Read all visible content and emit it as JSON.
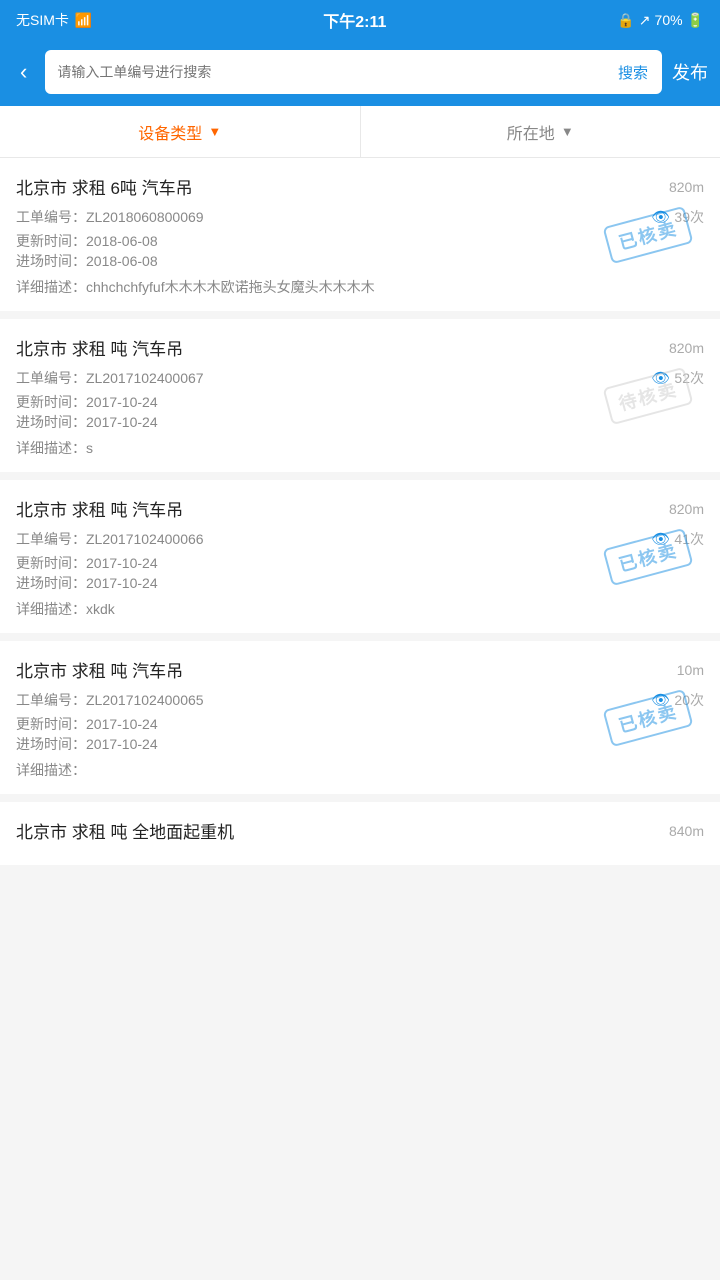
{
  "statusBar": {
    "left": "无SIM卡 🛜",
    "time": "下午2:11",
    "battery": "70%"
  },
  "header": {
    "backLabel": "‹",
    "searchPlaceholder": "请输入工单编号进行搜索",
    "searchBtnLabel": "搜索",
    "publishBtnLabel": "发布"
  },
  "filterBar": {
    "deviceType": {
      "label": "设备类型",
      "active": true
    },
    "location": {
      "label": "所在地",
      "active": false
    }
  },
  "items": [
    {
      "title": "北京市 求租 6吨 汽车吊",
      "distance": "820m",
      "orderNo": "工单编号：ZL2018060800069",
      "views": "39次",
      "updateTime": "更新时间：2018-06-08",
      "entryTime": "进场时间：2018-06-08",
      "desc": "详细描述：chhchchfyfuf木木木木欧诺拖头女魔头木木木木",
      "stamp": "已核卖",
      "stampType": "verified"
    },
    {
      "title": "北京市 求租 吨 汽车吊",
      "distance": "820m",
      "orderNo": "工单编号：ZL2017102400067",
      "views": "52次",
      "updateTime": "更新时间：2017-10-24",
      "entryTime": "进场时间：2017-10-24",
      "desc": "详细描述：s",
      "stamp": "待核卖",
      "stampType": "pending"
    },
    {
      "title": "北京市 求租 吨 汽车吊",
      "distance": "820m",
      "orderNo": "工单编号：ZL2017102400066",
      "views": "41次",
      "updateTime": "更新时间：2017-10-24",
      "entryTime": "进场时间：2017-10-24",
      "desc": "详细描述：xkdk",
      "stamp": "已核卖",
      "stampType": "verified"
    },
    {
      "title": "北京市 求租 吨 汽车吊",
      "distance": "10m",
      "orderNo": "工单编号：ZL2017102400065",
      "views": "20次",
      "updateTime": "更新时间：2017-10-24",
      "entryTime": "进场时间：2017-10-24",
      "desc": "详细描述：",
      "stamp": "已核卖",
      "stampType": "verified"
    },
    {
      "title": "北京市 求租 吨 全地面起重机",
      "distance": "840m",
      "orderNo": "",
      "views": "",
      "updateTime": "",
      "entryTime": "",
      "desc": "",
      "stamp": "",
      "stampType": ""
    }
  ]
}
